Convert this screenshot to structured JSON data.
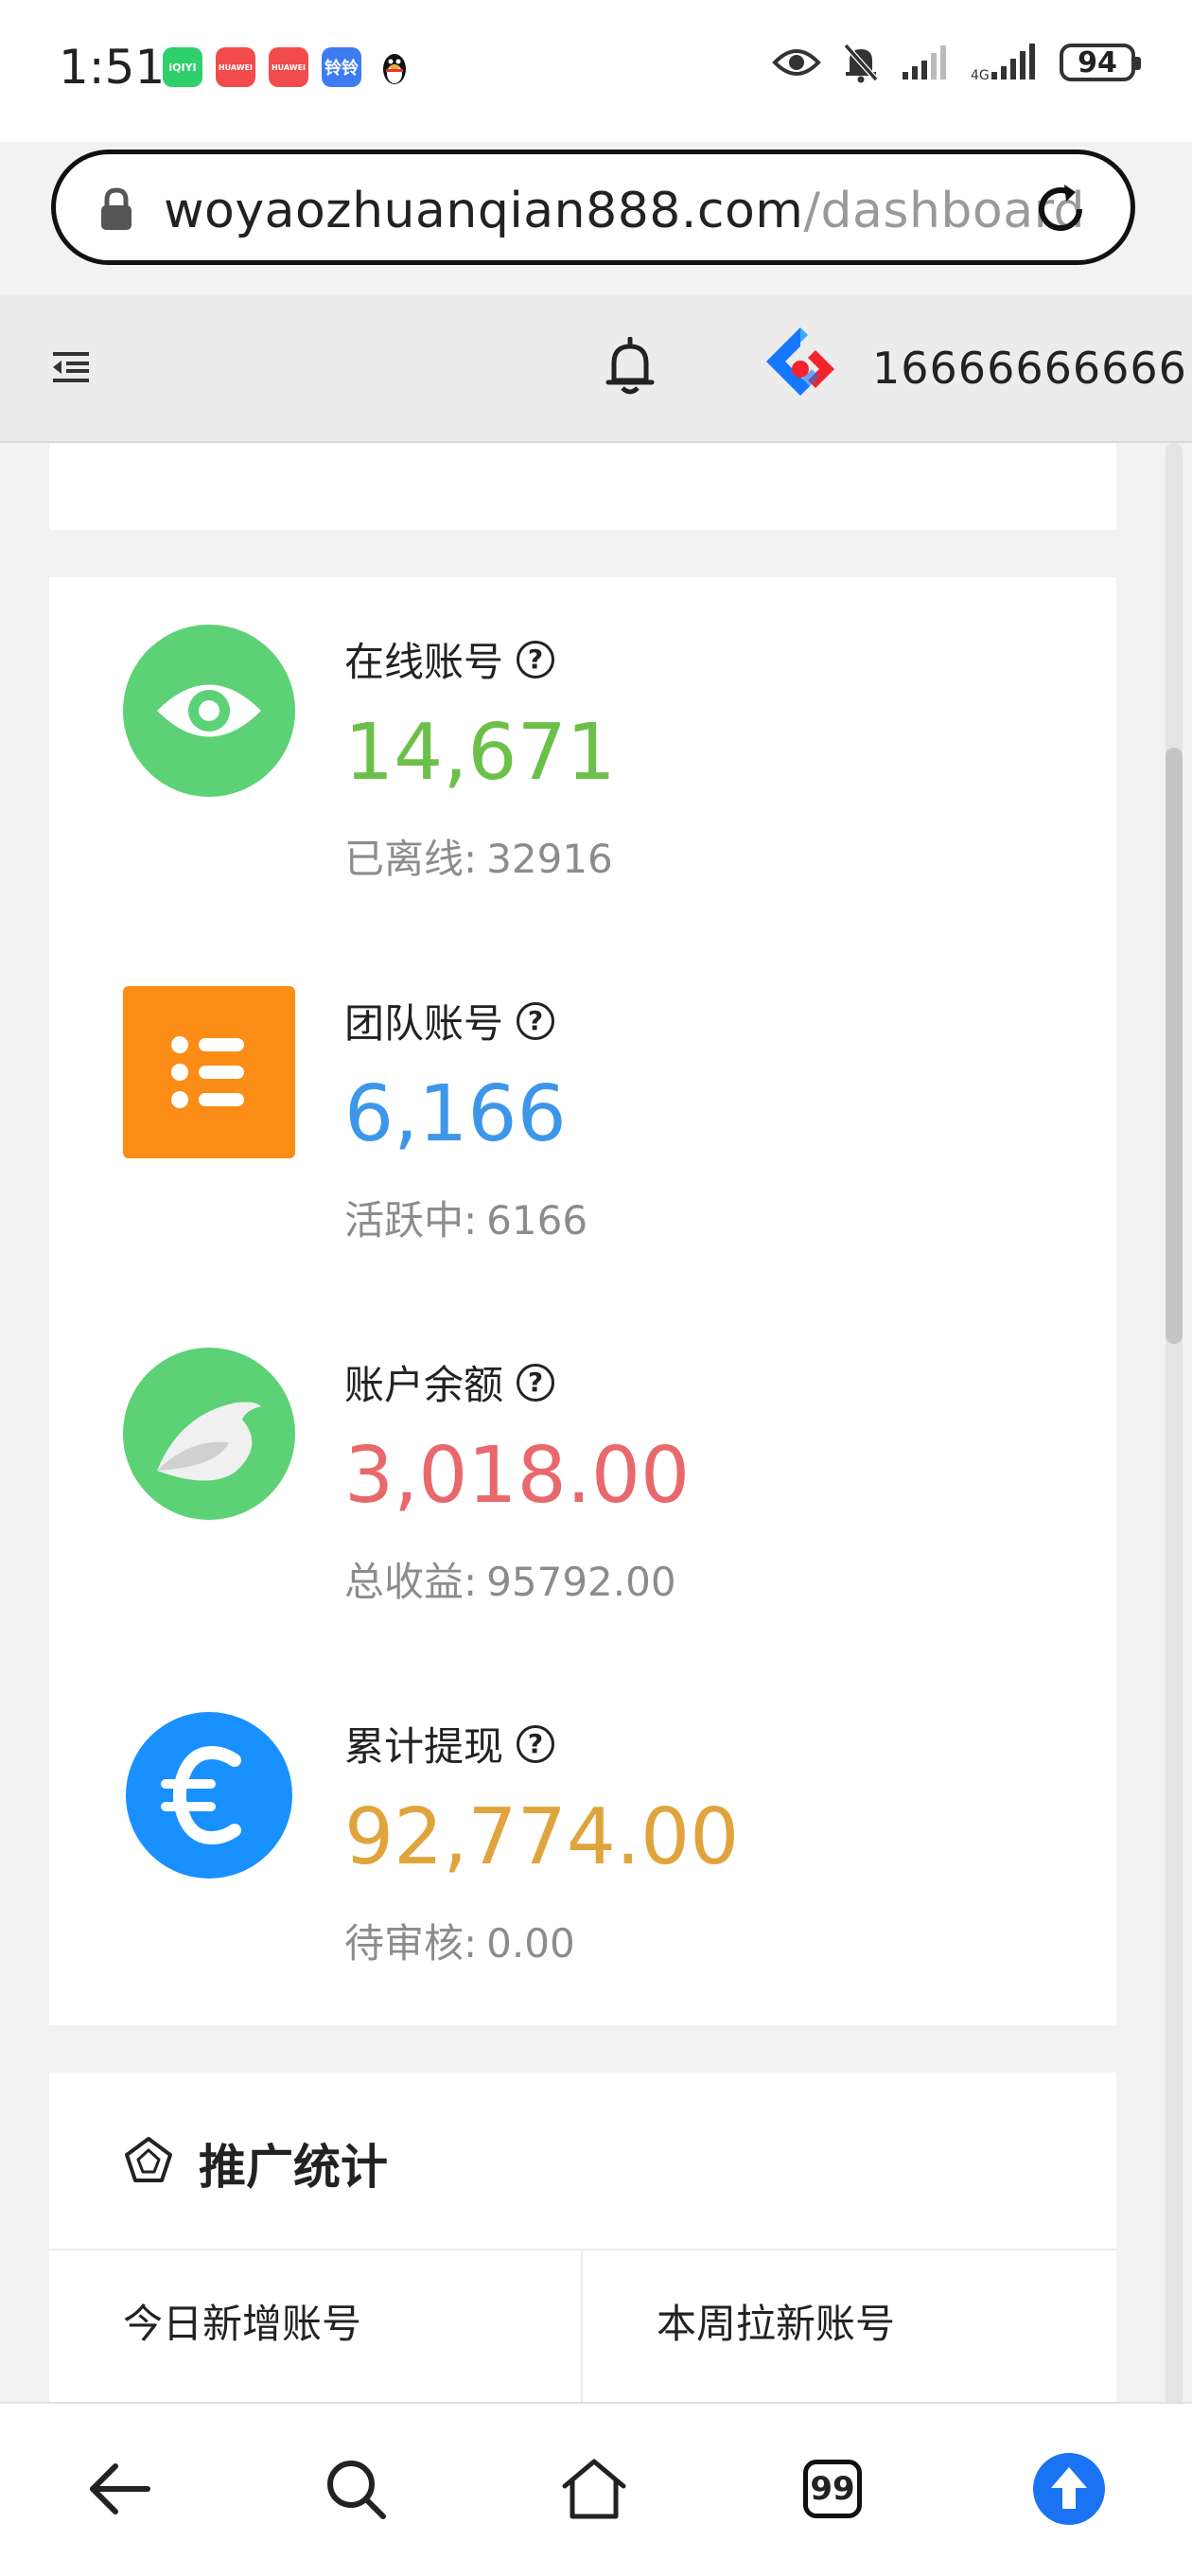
{
  "status_bar": {
    "time": "1:51",
    "apps": [
      {
        "icon": "iqiyi-icon",
        "label": "iQIYI",
        "color": "#2fcf6b"
      },
      {
        "icon": "huawei-icon",
        "label": "HUAWEI",
        "color": "#f24b4b"
      },
      {
        "icon": "huawei-icon",
        "label": "HUAWEI",
        "color": "#f24b4b"
      },
      {
        "icon": "app-icon",
        "label": "铃铃",
        "color": "#3d7cf2"
      },
      {
        "icon": "qq-penguin-icon",
        "label": "",
        "color": "#ffffff"
      }
    ],
    "battery": "94"
  },
  "browser": {
    "url_host": "woyaozhuanqian888.com",
    "url_path": "/dashboard"
  },
  "header": {
    "phone": "16666666666"
  },
  "stats": [
    {
      "title": "在线账号",
      "value": "14,671",
      "sub_label": "已离线:",
      "sub_value": "32916",
      "color": "#6cc04a",
      "icon": "eye-icon",
      "icon_bg": "#5cd176"
    },
    {
      "title": "团队账号",
      "value": "6,166",
      "sub_label": "活跃中:",
      "sub_value": "6166",
      "color": "#3d97e8",
      "icon": "list-icon",
      "icon_bg": "#fb8c16"
    },
    {
      "title": "账户余额",
      "value": "3,018.00",
      "sub_label": "总收益:",
      "sub_value": "95792.00",
      "color": "#e8686c",
      "icon": "bird-icon",
      "icon_bg": "#5cd176"
    },
    {
      "title": "累计提现",
      "value": "92,774.00",
      "sub_label": "待审核:",
      "sub_value": "0.00",
      "color": "#e0a43c",
      "icon": "euro-icon",
      "icon_bg": "#1890ff"
    }
  ],
  "promotion": {
    "title": "推广统计",
    "today_label": "今日新增账号",
    "week_label": "本周拉新账号"
  },
  "bottom_nav": {
    "tab_count": "99",
    "accent": "#1a73f2"
  }
}
